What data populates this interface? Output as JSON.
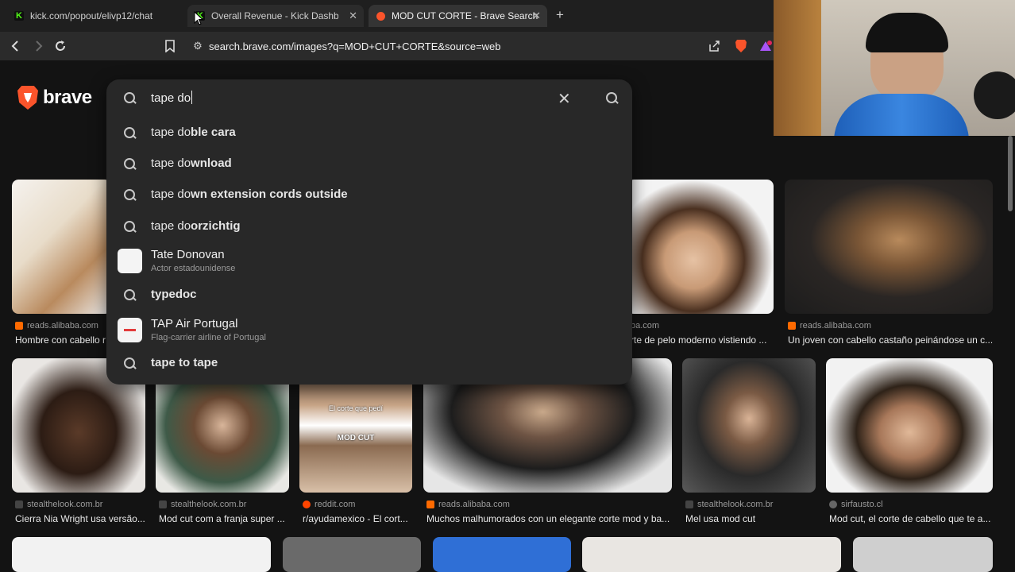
{
  "tabs": [
    {
      "title": "kick.com/popout/elivp12/chat",
      "favicon": "kick-icon"
    },
    {
      "title": "Overall Revenue - Kick Dashboard",
      "favicon": "kick-icon",
      "close": "✕"
    },
    {
      "title": "MOD CUT CORTE - Brave Search",
      "favicon": "brave-icon",
      "close": "✕"
    }
  ],
  "new_tab": "+",
  "address": {
    "url": "search.brave.com/images?q=MOD+CUT+CORTE&source=web"
  },
  "logo": {
    "text": "brave"
  },
  "search": {
    "query": "tape do",
    "suggestions": [
      {
        "prefix": "tape do",
        "suffix": "ble cara"
      },
      {
        "prefix": "tape do",
        "suffix": "wnload"
      },
      {
        "prefix": "tape do",
        "suffix": "wn extension cords outside"
      },
      {
        "prefix": "tape do",
        "suffix": "orzichtig"
      }
    ],
    "entity1": {
      "name": "Tate Donovan",
      "desc": "Actor estadounidense"
    },
    "plain1": "typedoc",
    "entity2": {
      "name": "TAP Air Portugal",
      "desc": "Flag-carrier airline of Portugal"
    },
    "plain2": "tape to tape"
  },
  "results_row1": [
    {
      "source": "reads.alibaba.com",
      "caption": "Hombre con cabello r"
    },
    {
      "source": "ba.com",
      "caption": "rte de pelo moderno vistiendo ..."
    },
    {
      "source": "reads.alibaba.com",
      "caption": "Un joven con cabello castaño peinándose un c..."
    }
  ],
  "results_row2": [
    {
      "source": "stealthelook.com.br",
      "caption": "Cierra Nia Wright usa versão..."
    },
    {
      "source": "stealthelook.com.br",
      "caption": "Mod cut com a franja super ..."
    },
    {
      "source": "reddit.com",
      "caption": "r/ayudamexico - El cort..."
    },
    {
      "source": "reads.alibaba.com",
      "caption": "Muchos malhumorados con un elegante corte mod y ba..."
    },
    {
      "source": "stealthelook.com.br",
      "caption": "Mel usa mod cut"
    },
    {
      "source": "sirfausto.cl",
      "caption": "Mod cut, el corte de cabello que te a..."
    }
  ],
  "image_overlay": {
    "line1": "El corte que pedí",
    "line2": "MOD CUT"
  }
}
